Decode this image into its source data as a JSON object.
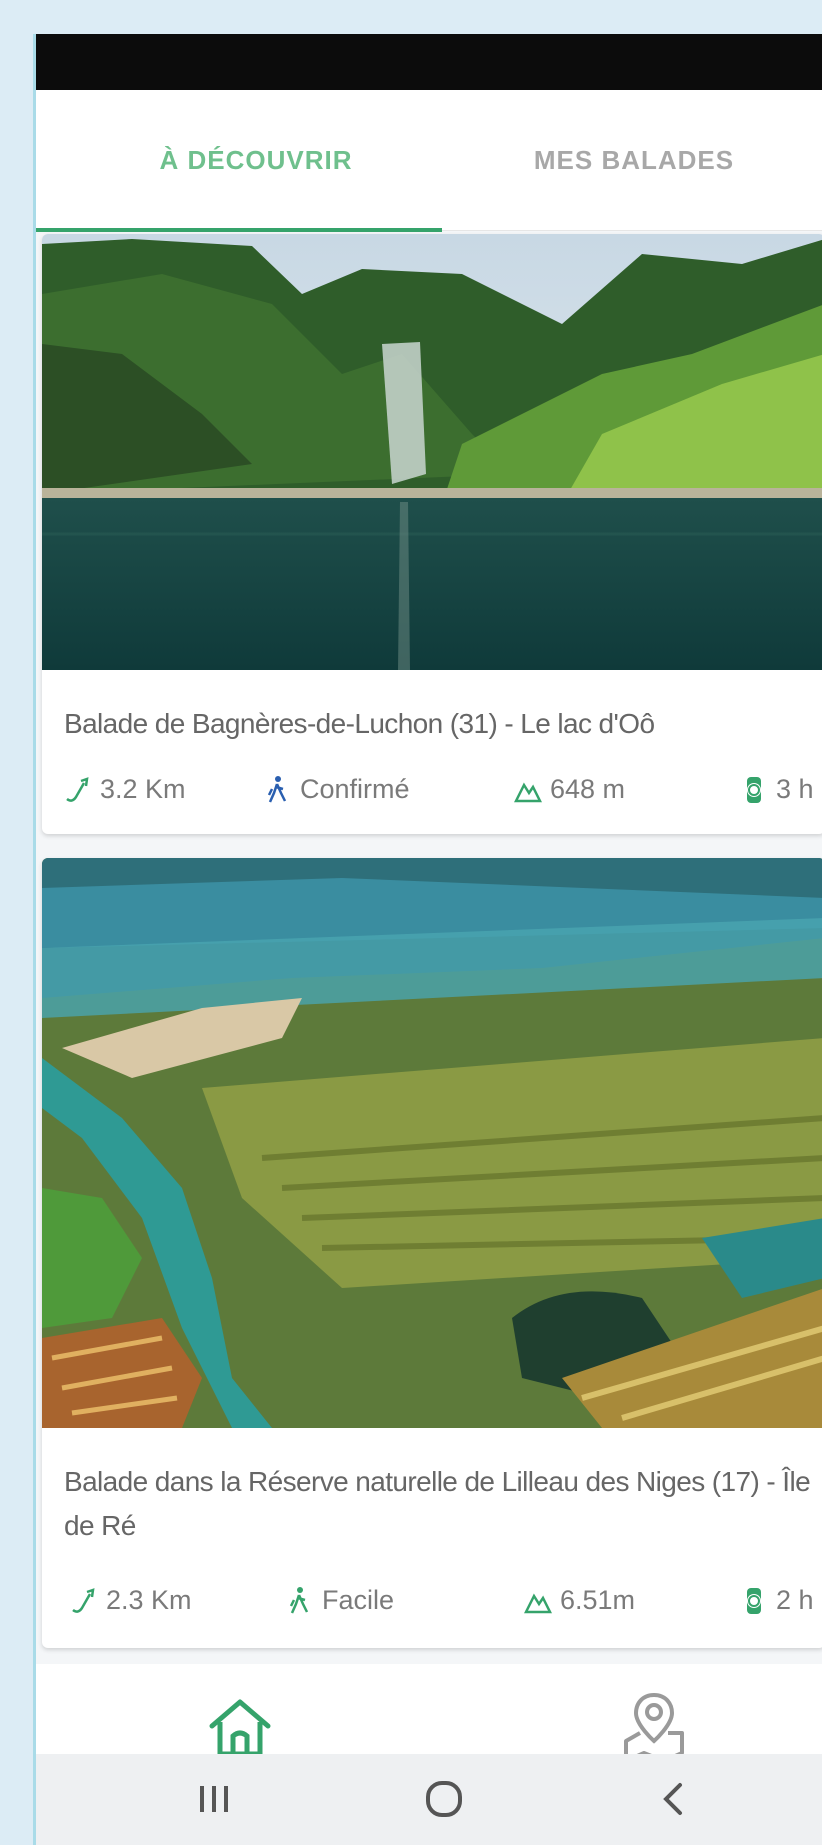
{
  "tabs": {
    "discover": "À DÉCOUVRIR",
    "mine": "MES BALADES"
  },
  "walks": [
    {
      "title": "Balade de Bagnères-de-Luchon (31) - Le lac d'Oô",
      "distance": "3.2 Km",
      "level": "Confirmé",
      "elevation": "648 m",
      "duration": "3 h"
    },
    {
      "title": "Balade dans la Réserve naturelle de Lilleau des Niges (17) - Île de Ré",
      "distance": "2.3 Km",
      "level": "Facile",
      "elevation": "6.51m",
      "duration": "2 h"
    }
  ],
  "icons": {
    "distance": "route-icon",
    "level": "hiker-icon",
    "elevation": "mountain-icon",
    "duration": "watch-icon",
    "home": "home-icon",
    "map": "map-pin-icon",
    "recent_apps": "recent-apps-icon",
    "system_home": "circle-home-icon",
    "back": "back-chevron-icon"
  },
  "colors": {
    "accent": "#35a36b",
    "tab_active": "#6fc08d",
    "tab_inactive": "#a8a8a8",
    "text": "#666666"
  }
}
